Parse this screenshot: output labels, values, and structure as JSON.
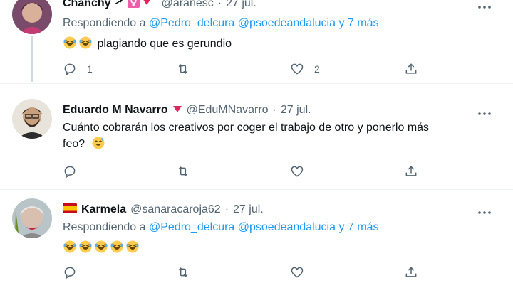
{
  "tweets": [
    {
      "name": "Chanchy",
      "handle": "@aranesc",
      "dot": "·",
      "date": "27 jul.",
      "replying_prefix": "Respondiendo a",
      "mention1": "@Pedro_delcura",
      "mention2": "@psoedeandalucia",
      "and_more": "y 7 más",
      "text": "plagiando que es gerundio",
      "reply_count": "1",
      "like_count": "2"
    },
    {
      "name": "Eduardo M Navarro",
      "handle": "@EduMNavarro",
      "dot": "·",
      "date": "27 jul.",
      "text_line1": "Cuánto cobrarán los creativos por coger el trabajo de otro y ponerlo más",
      "text_line2": "feo?"
    },
    {
      "name": "Karmela",
      "handle": "@sanaracaroja62",
      "dot": "·",
      "date": "27 jul.",
      "replying_prefix": "Respondiendo a",
      "mention1": "@Pedro_delcura",
      "mention2": "@psoedeandalucia",
      "and_more": "y 7 más"
    }
  ],
  "icons": {
    "reply": "reply-icon",
    "retweet": "retweet-icon",
    "like": "heart-icon",
    "share": "share-icon",
    "more": "more-icon"
  },
  "colors": {
    "link": "#1d9bf0",
    "secondary_text": "#536471",
    "rose": "#e0245e"
  }
}
